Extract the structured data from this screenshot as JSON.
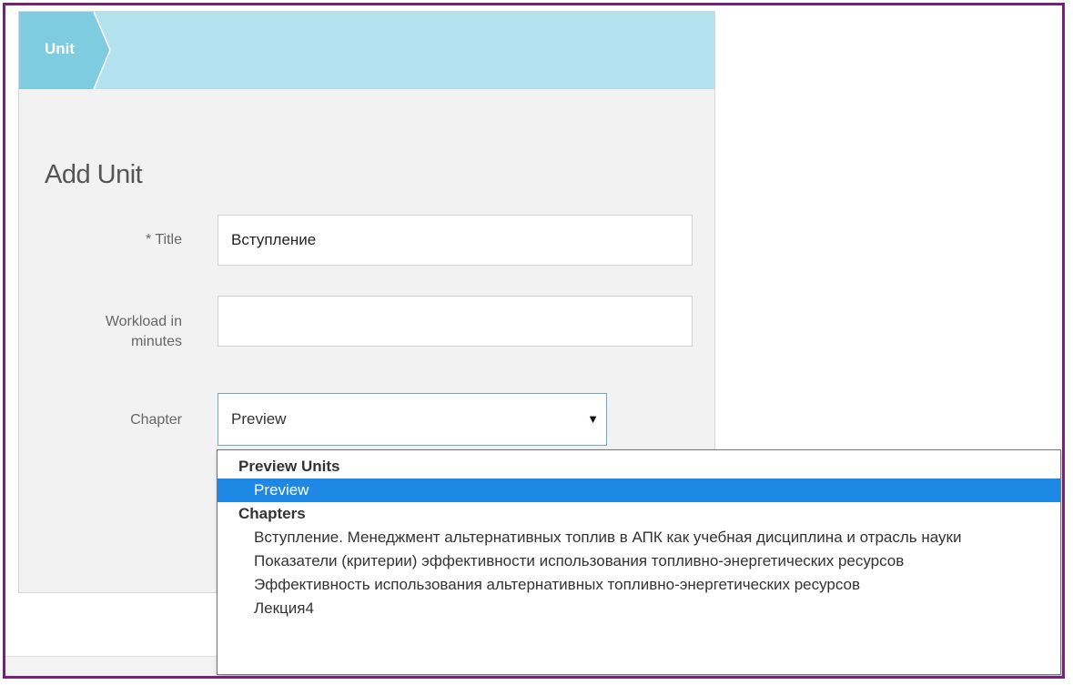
{
  "breadcrumb": {
    "label": "Unit"
  },
  "form": {
    "title": "Add Unit",
    "title_field": {
      "required_marker": "*",
      "label": "Title",
      "value": "Вступление"
    },
    "workload_field": {
      "label_line1": "Workload in",
      "label_line2": "minutes",
      "value": ""
    },
    "chapter_field": {
      "label": "Chapter",
      "selected": "Preview",
      "arrow": "▼"
    }
  },
  "dropdown": {
    "groups": [
      {
        "label": "Preview Units",
        "options": [
          {
            "label": "Preview",
            "selected": true
          }
        ]
      },
      {
        "label": "Chapters",
        "options": [
          {
            "label": "Вступление. Менеджмент альтернативных топлив в АПК как учебная дисциплина и отрасль науки"
          },
          {
            "label": "Показатели (критерии) эффективности использования топливно-энергетических ресурсов"
          },
          {
            "label": "Эффективность использования альтернативных топливно-энергетических ресурсов"
          },
          {
            "label": "Лекция4"
          }
        ]
      }
    ]
  },
  "colors": {
    "header_bg": "#b3e2ee",
    "crumb_bg": "#7fcbe0",
    "selected_option": "#1e88e5",
    "frame_border": "#7b1f7f"
  }
}
